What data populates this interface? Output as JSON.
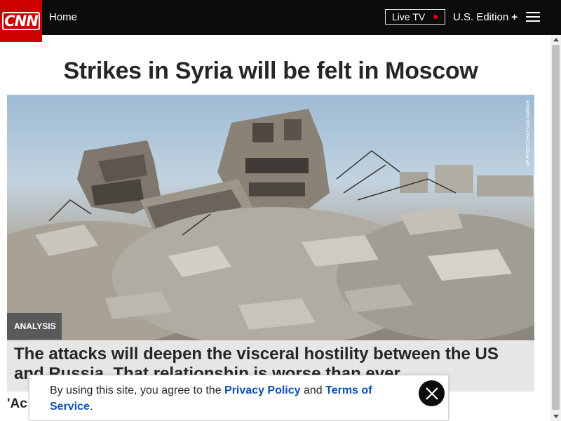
{
  "header": {
    "logo_text": "CNN",
    "home_label": "Home",
    "live_tv_label": "Live TV",
    "edition_label": "U.S. Edition",
    "edition_plus": "+"
  },
  "article": {
    "headline": "Strikes in Syria will be felt in Moscow",
    "photo_credit": "AP PHOTO/HASSAN AMMAR",
    "badge": "ANALYSIS",
    "caption": "The attacks will deepen the visceral hostility between the US and Russia. That relationship is worse than ever",
    "next_item_partial": "'Ac"
  },
  "cookie_banner": {
    "text_before": "By using this site, you agree to the ",
    "privacy_link": "Privacy Policy",
    "text_middle": " and ",
    "terms_link": "Terms of Service",
    "text_after": "."
  },
  "colors": {
    "header_bg": "#0c0c0c",
    "brand_red": "#cc0000",
    "link_blue": "#0c4fb7",
    "caption_bg": "#e6e6e6"
  },
  "icons": {
    "menu": "hamburger-menu-icon",
    "close": "close-icon",
    "live": "live-dot-icon"
  }
}
